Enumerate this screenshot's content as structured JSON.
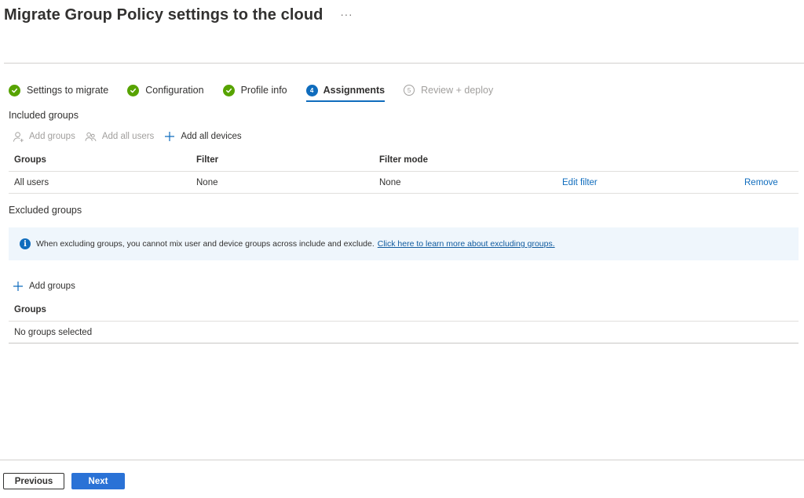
{
  "header": {
    "title": "Migrate Group Policy settings to the cloud",
    "more_label": "···"
  },
  "stepper": {
    "steps": [
      {
        "label": "Settings to migrate",
        "state": "complete",
        "icon": "check-icon"
      },
      {
        "label": "Configuration",
        "state": "complete",
        "icon": "check-icon"
      },
      {
        "label": "Profile info",
        "state": "complete",
        "icon": "check-icon"
      },
      {
        "label": "Assignments",
        "state": "active",
        "number": "4"
      },
      {
        "label": "Review + deploy",
        "state": "disabled",
        "number": "5"
      }
    ]
  },
  "included": {
    "title": "Included groups",
    "toolbar": {
      "add_groups": "Add groups",
      "add_all_users": "Add all users",
      "add_all_devices": "Add all devices"
    },
    "columns": [
      "Groups",
      "Filter",
      "Filter mode"
    ],
    "rows": [
      {
        "group": "All users",
        "filter": "None",
        "filter_mode": "None",
        "edit_filter": "Edit filter",
        "remove": "Remove"
      }
    ]
  },
  "excluded": {
    "title": "Excluded groups",
    "info": {
      "text": "When excluding groups, you cannot mix user and device groups across include and exclude.",
      "link": "Click here to learn more about excluding groups."
    },
    "add_groups": "Add groups",
    "column": "Groups",
    "empty_text": "No groups selected"
  },
  "footer": {
    "previous": "Previous",
    "next": "Next"
  },
  "colors": {
    "accent": "#0f6cbd",
    "success": "#57a300",
    "primary_button": "#2a72d6",
    "info_bg": "#eff6fc"
  }
}
